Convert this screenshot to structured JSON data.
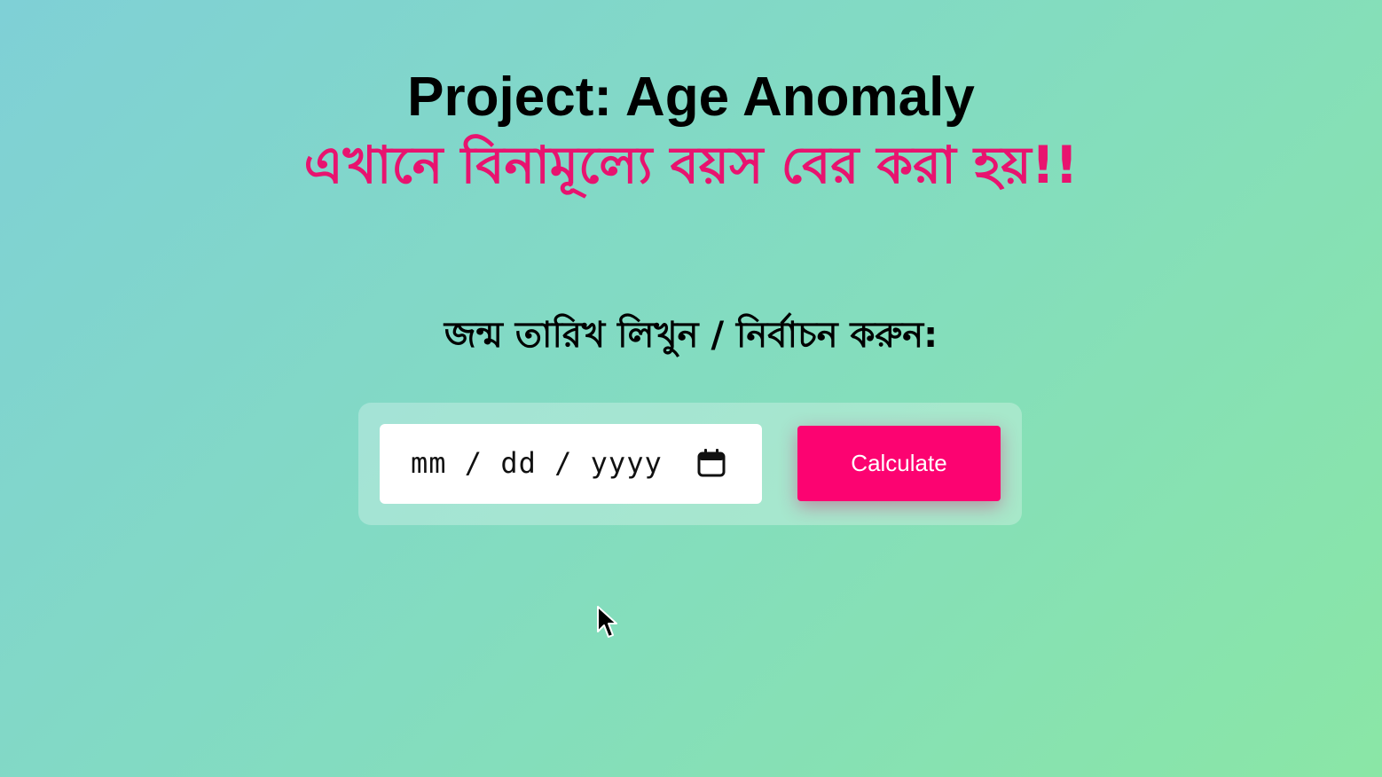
{
  "header": {
    "title": "Project: Age Anomaly",
    "subtitle": "এখানে বিনামূল্যে বয়স বের করা হয়!!"
  },
  "form": {
    "prompt": "জন্ম তারিখ লিখুন / নির্বাচন করুন:",
    "date_placeholder": "mm / dd / yyyy",
    "calendar_icon": "calendar-icon",
    "submit_label": "Calculate"
  },
  "colors": {
    "accent": "#fc0371",
    "subtitle": "#e8136f",
    "background_start": "#7fd0d6",
    "background_end": "#8ae6a6"
  }
}
